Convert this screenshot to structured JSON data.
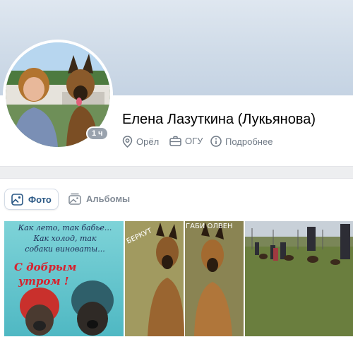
{
  "profile": {
    "name": "Елена Лазуткина (Лукьянова)",
    "online_badge": "1 ч",
    "city": "Орёл",
    "work": "ОГУ",
    "details": "Подробнее"
  },
  "tabs": [
    {
      "label": "Фото",
      "icon": "photo-icon",
      "active": true
    },
    {
      "label": "Альбомы",
      "icon": "albums-icon",
      "active": false
    }
  ],
  "photos": [
    {
      "caption_lines": [
        "Как лето, так бабье...",
        "Как холод, так",
        "собаки виноваты..."
      ],
      "greeting_lines": [
        "С добрым",
        "утром !"
      ]
    },
    {
      "label_left": "БЕРКУТ",
      "label_right": "ГАБИ ОЛВЕН"
    },
    {}
  ],
  "colors": {
    "accent": "#2a5885",
    "secondary_text": "#6f7985",
    "background": "#edeef0"
  }
}
